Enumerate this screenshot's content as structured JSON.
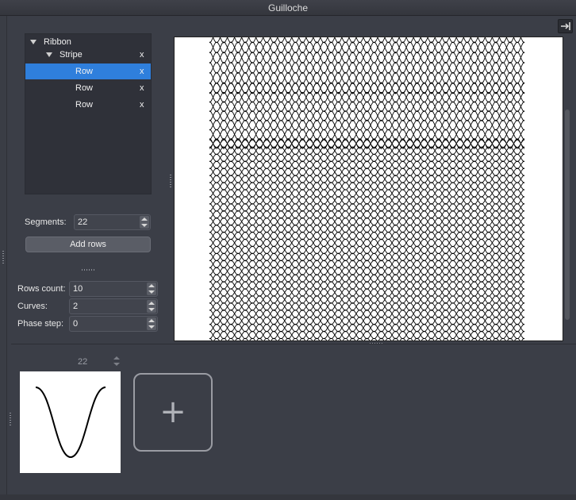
{
  "window": {
    "title": "Guilloche"
  },
  "tree": {
    "items": [
      {
        "label": "Ribbon",
        "level": 0,
        "expandable": true,
        "selected": false,
        "close": ""
      },
      {
        "label": "Stripe",
        "level": 1,
        "expandable": true,
        "selected": false,
        "close": "x"
      },
      {
        "label": "Row",
        "level": 2,
        "expandable": false,
        "selected": true,
        "close": "x"
      },
      {
        "label": "Row",
        "level": 2,
        "expandable": false,
        "selected": false,
        "close": "x"
      },
      {
        "label": "Row",
        "level": 2,
        "expandable": false,
        "selected": false,
        "close": "x"
      }
    ]
  },
  "segments": {
    "label": "Segments:",
    "value": "22"
  },
  "add_rows": {
    "label": "Add rows"
  },
  "rows_count": {
    "label": "Rows count:",
    "value": "10"
  },
  "curves": {
    "label": "Curves:",
    "value": "2"
  },
  "phase_step": {
    "label": "Phase step:",
    "value": "0"
  },
  "curve_editor": {
    "segments_value": "22",
    "add_label": "+"
  },
  "icons": {
    "collapse": "sidebar-collapse-icon",
    "expand": "disclosure-triangle-icon",
    "close": "close-x",
    "add": "plus-icon"
  },
  "colors": {
    "background": "#3b3e47",
    "selection": "#2f7fdc",
    "canvas": "#ffffff",
    "line": "#000000"
  }
}
